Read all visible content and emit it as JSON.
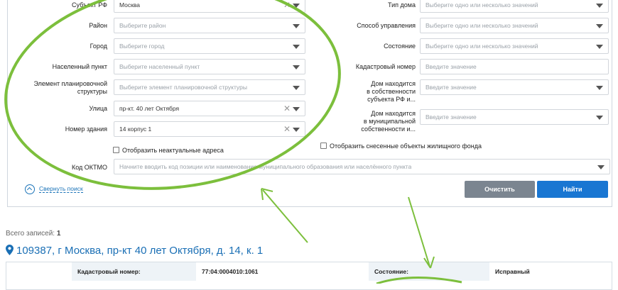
{
  "form": {
    "subject": {
      "label": "Субъект РФ",
      "value": "Москва"
    },
    "district": {
      "label": "Район",
      "placeholder": "Выберите район"
    },
    "city": {
      "label": "Город",
      "placeholder": "Выберите город"
    },
    "locality": {
      "label": "Населенный пункт",
      "placeholder": "Выберите населенный пункт"
    },
    "planning": {
      "label_1": "Элемент планировочной",
      "label_2": "структуры",
      "placeholder": "Выберите элемент планировочной структуры"
    },
    "street": {
      "label": "Улица",
      "value": "пр-кт. 40 лет Октября"
    },
    "building": {
      "label": "Номер здания",
      "value": "14 корпус 1"
    },
    "show_outdated": "Отобразить неактуальные адреса",
    "house_type": {
      "label": "Тип дома",
      "placeholder": "Выберите одно или несколько значений"
    },
    "management": {
      "label": "Способ управления",
      "placeholder": "Выберите одно или несколько значений"
    },
    "state": {
      "label": "Состояние",
      "placeholder": "Выберите одно или несколько значений"
    },
    "cadastral": {
      "label": "Кадастровый номер",
      "placeholder": "Введите значение"
    },
    "subject_owned": {
      "label_1": "Дом находится",
      "label_2": "в собственности",
      "label_3": "субъекта РФ и...",
      "placeholder": "Введите значение"
    },
    "municipal_owned": {
      "label_1": "Дом находится",
      "label_2": "в муниципальной",
      "label_3": "собственности и...",
      "placeholder": "Введите значение"
    },
    "show_demolished": "Отобразить снесенные объекты жилищного фонда",
    "oktmo": {
      "label": "Код ОКТМО",
      "placeholder": "Начните вводить код позиции или наименование муниципального образования или населённого пункта"
    },
    "collapse": "Свернуть поиск",
    "clear_button": "Очистить",
    "find_button": "Найти"
  },
  "results": {
    "total_label": "Всего записей:",
    "total_count": "1",
    "address": "109387, г Москва, пр-кт 40 лет Октября, д. 14, к. 1",
    "cadastral_label": "Кадастровый номер:",
    "cadastral_value": "77:04:0004010:1061",
    "state_label": "Состояние:",
    "state_value": "Исправный"
  },
  "colors": {
    "accent": "#1976d2",
    "annotation_green": "#7cbf3c",
    "clear_button": "#7b8590"
  },
  "icons": [
    "chevron-down-icon",
    "clear-x-icon",
    "checkbox-icon",
    "collapse-up-icon",
    "location-pin-icon"
  ]
}
